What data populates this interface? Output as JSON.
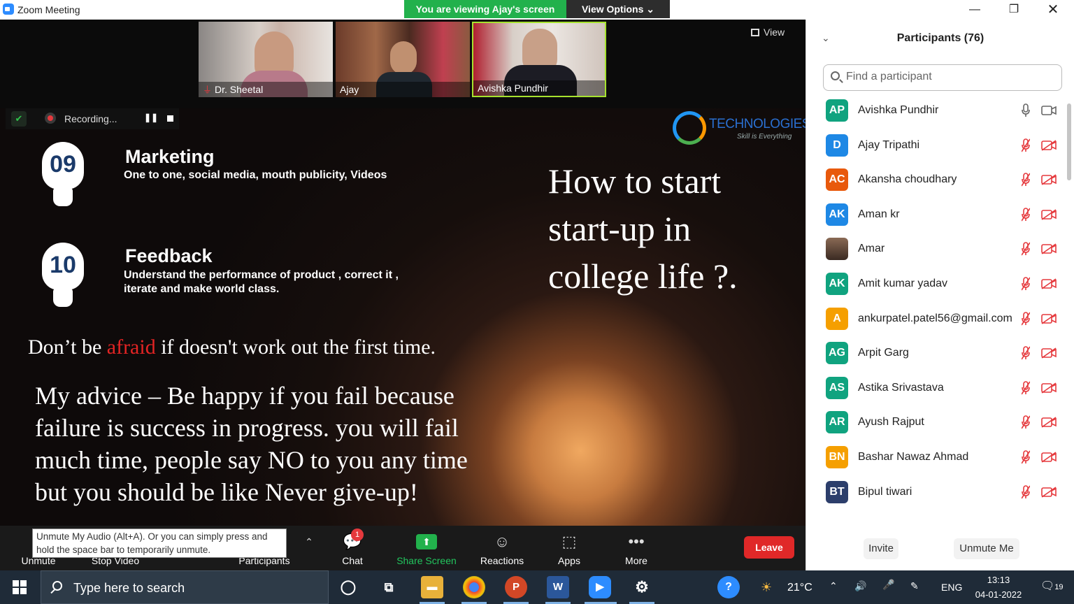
{
  "window": {
    "title": "Zoom Meeting",
    "viewing_banner": "You are viewing Ajay's screen",
    "view_options": "View Options"
  },
  "gallery": {
    "view_label": "View",
    "tiles": [
      {
        "name": "Dr. Sheetal",
        "muted": true
      },
      {
        "name": "Ajay",
        "muted": false
      },
      {
        "name": "Avishka Pundhir",
        "muted": false,
        "active_speaker": true
      }
    ]
  },
  "recording": {
    "status": "Recording..."
  },
  "slide": {
    "logo_name": "TECHNOLOGIES",
    "logo_tagline": "Skill is Everything",
    "points": [
      {
        "number": "09",
        "title": "Marketing",
        "desc": "One to one, social media, mouth publicity, Videos"
      },
      {
        "number": "10",
        "title": "Feedback",
        "desc": "Understand the performance of product , correct it , iterate and make world class."
      }
    ],
    "heading": "How to start start-up in college life ?.",
    "quote_pre": "Don’t be ",
    "quote_accent": "afraid",
    "quote_post": " if doesn't work out the first time.",
    "advice": "My advice – Be happy if you fail because failure is success in progress. you will fail much time, people say NO to you any time but you should be like Never give-up!"
  },
  "toolbar": {
    "unmute": "Unmute",
    "stop_video": "Stop Video",
    "participants": "Participants",
    "chat": "Chat",
    "chat_badge": "1",
    "share_screen": "Share Screen",
    "reactions": "Reactions",
    "apps": "Apps",
    "more": "More",
    "leave": "Leave",
    "tooltip": "Unmute My Audio (Alt+A). Or you can simply press and hold the space bar to temporarily unmute."
  },
  "participants_panel": {
    "title": "Participants (76)",
    "search_placeholder": "Find a participant",
    "invite": "Invite",
    "unmute_me": "Unmute Me",
    "list": [
      {
        "initials": "AP",
        "name": "Avishka Pundhir",
        "color": "#10a37f",
        "mic_on": true,
        "cam_on": true
      },
      {
        "initials": "D",
        "name": "Ajay Tripathi",
        "color": "#1e88e5",
        "mic_on": false,
        "cam_on": false
      },
      {
        "initials": "AC",
        "name": "Akansha choudhary",
        "color": "#e8590c",
        "mic_on": false,
        "cam_on": false
      },
      {
        "initials": "AK",
        "name": "Aman kr",
        "color": "#1e88e5",
        "mic_on": false,
        "cam_on": false
      },
      {
        "initials": "",
        "name": "Amar",
        "color": "",
        "photo": true,
        "mic_on": false,
        "cam_on": false
      },
      {
        "initials": "AK",
        "name": "Amit kumar yadav",
        "color": "#10a37f",
        "mic_on": false,
        "cam_on": false
      },
      {
        "initials": "A",
        "name": "ankurpatel.patel56@gmail.com",
        "color": "#f59f00",
        "mic_on": false,
        "cam_on": false
      },
      {
        "initials": "AG",
        "name": "Arpit Garg",
        "color": "#10a37f",
        "mic_on": false,
        "cam_on": false
      },
      {
        "initials": "AS",
        "name": "Astika Srivastava",
        "color": "#10a37f",
        "mic_on": false,
        "cam_on": false
      },
      {
        "initials": "AR",
        "name": "Ayush Rajput",
        "color": "#10a37f",
        "mic_on": false,
        "cam_on": false
      },
      {
        "initials": "BN",
        "name": "Bashar Nawaz Ahmad",
        "color": "#f59f00",
        "mic_on": false,
        "cam_on": false
      },
      {
        "initials": "BT",
        "name": "Bipul tiwari",
        "color": "#2c3e6b",
        "mic_on": false,
        "cam_on": false
      }
    ]
  },
  "taskbar": {
    "search_placeholder": "Type here to search",
    "temperature": "21°C",
    "language": "ENG",
    "time": "13:13",
    "date": "04-01-2022",
    "notification_count": "19"
  }
}
